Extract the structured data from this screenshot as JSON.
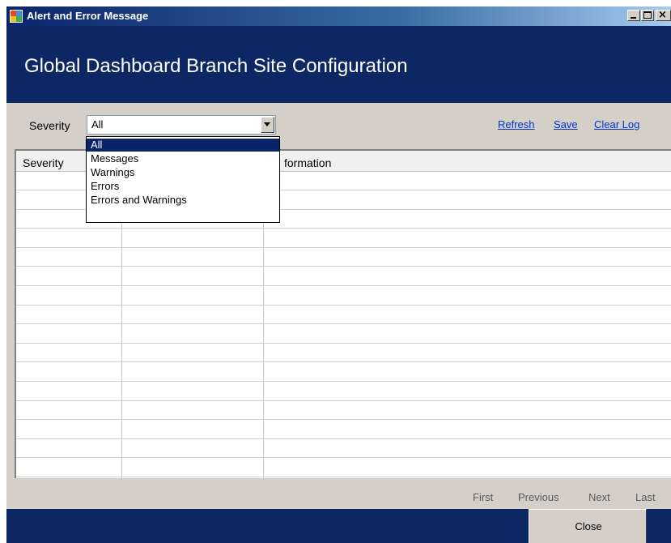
{
  "window": {
    "title": "Alert and Error Message",
    "header_title": "Global Dashboard Branch Site Configuration"
  },
  "toolbar": {
    "severity_label": "Severity",
    "severity_value": "All",
    "refresh": "Refresh",
    "save": "Save",
    "clear_log": "Clear Log"
  },
  "dropdown": {
    "options": [
      "All",
      "Messages",
      "Warnings",
      "Errors",
      "Errors and Warnings"
    ],
    "selected": "All"
  },
  "grid": {
    "columns": [
      "Severity",
      "formation"
    ]
  },
  "pager": {
    "first": "First",
    "previous": "Previous",
    "next": "Next",
    "last": "Last"
  },
  "footer": {
    "close": "Close"
  },
  "colors": {
    "header_bg": "#0c2763",
    "dialog_bg": "#d4d0c8",
    "selection": "#0a246a",
    "link": "#0033cc"
  }
}
